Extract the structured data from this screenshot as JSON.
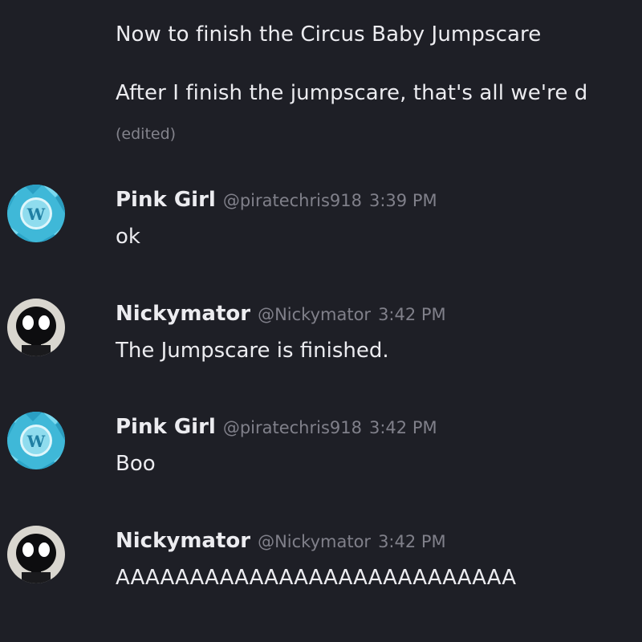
{
  "continued_messages": [
    "Now to finish the Circus Baby Jumpscare",
    "After I finish the jumpscare, that's all we're d"
  ],
  "edited_label": "(edited)",
  "messages": [
    {
      "username": "Pink Girl",
      "handle": "@piratechris918",
      "time": "3:39 PM",
      "text": "ok",
      "avatar": "pink-girl-avatar"
    },
    {
      "username": "Nickymator",
      "handle": "@Nickymator",
      "time": "3:42 PM",
      "text": "The Jumpscare is finished.",
      "avatar": "nickymator-avatar"
    },
    {
      "username": "Pink Girl",
      "handle": "@piratechris918",
      "time": "3:42 PM",
      "text": "Boo",
      "avatar": "pink-girl-avatar"
    },
    {
      "username": "Nickymator",
      "handle": "@Nickymator",
      "time": "3:42 PM",
      "text": "AAAAAAAAAAAAAAAAAAAAAAAAAAA",
      "avatar": "nickymator-avatar"
    }
  ],
  "colors": {
    "background": "#1e1f26",
    "text": "#ececf0",
    "muted": "#80808a",
    "pink_girl_avatar": "#3fb8d8",
    "nickymator_avatar": "#d9d6cf"
  }
}
